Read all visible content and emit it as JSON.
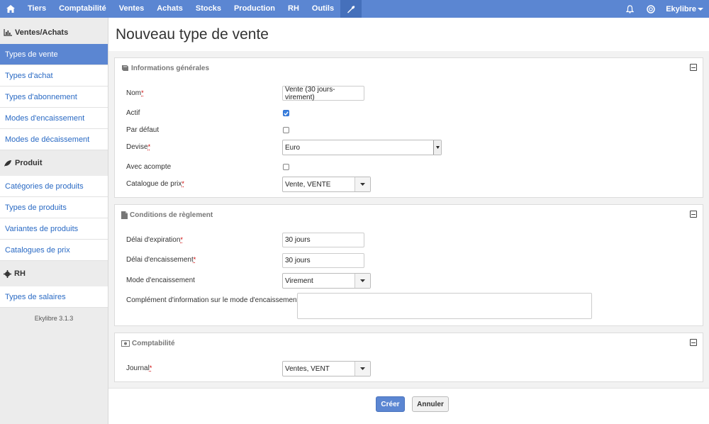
{
  "topnav": {
    "items": [
      "Tiers",
      "Comptabilité",
      "Ventes",
      "Achats",
      "Stocks",
      "Production",
      "RH",
      "Outils"
    ],
    "user": "Ekylibre"
  },
  "sidebar": {
    "sections": [
      {
        "title": "Ventes/Achats",
        "icon": "bar-chart-icon",
        "items": [
          "Types de vente",
          "Types d'achat",
          "Types d'abonnement",
          "Modes d'encaissement",
          "Modes de décaissement"
        ]
      },
      {
        "title": "Produit",
        "icon": "leaf-icon",
        "items": [
          "Catégories de produits",
          "Types de produits",
          "Variantes de produits",
          "Catalogues de prix"
        ]
      },
      {
        "title": "RH",
        "icon": "gear-icon",
        "items": [
          "Types de salaires"
        ]
      }
    ],
    "active_item": "Types de vente",
    "version": "Ekylibre 3.1.3"
  },
  "page": {
    "title": "Nouveau type de vente"
  },
  "general": {
    "title": "Informations générales",
    "nom_label": "Nom",
    "nom_value": "Vente (30 jours-virement)",
    "actif_label": "Actif",
    "actif_checked": true,
    "defaut_label": "Par défaut",
    "defaut_checked": false,
    "devise_label": "Devise",
    "devise_value": "Euro",
    "acompte_label": "Avec acompte",
    "acompte_checked": false,
    "catalogue_label": "Catalogue de prix",
    "catalogue_value": "Vente, VENTE"
  },
  "conditions": {
    "title": "Conditions de règlement",
    "expiration_label": "Délai d'expiration",
    "expiration_value": "30 jours",
    "encaissement_label": "Délai d'encaissement",
    "encaissement_value": "30 jours",
    "mode_label": "Mode d'encaissement",
    "mode_value": "Virement",
    "complement_label": "Complément d'information sur le mode d'encaissement",
    "complement_value": ""
  },
  "compta": {
    "title": "Comptabilité",
    "journal_label": "Journal",
    "journal_value": "Ventes, VENT"
  },
  "actions": {
    "create": "Créer",
    "cancel": "Annuler"
  },
  "colors": {
    "accent": "#5b86d2",
    "required": "#cc0000"
  }
}
